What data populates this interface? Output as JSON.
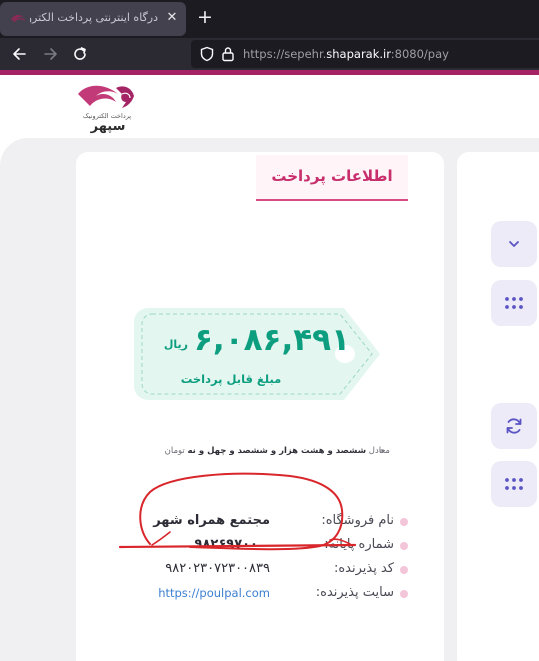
{
  "browser": {
    "tab_title": "درگاه اینترنتی پرداخت الکترونیک",
    "url_prefix": "https://sepehr.",
    "url_host": "shaparak.ir",
    "url_suffix": ":8080/pay"
  },
  "logo": {
    "subtitle": "پرداخت الکترونیک",
    "name": "سپهر"
  },
  "header": {
    "title": "اطلاعات پرداخت"
  },
  "amount": {
    "value": "۶,۰۸۶,۴۹۱",
    "unit": "ریال",
    "label": "مبلغ قابل پرداخت"
  },
  "amount_words": {
    "prefix": "معادل",
    "words": "ششصد و هشت هزار و ششصد و چهل و نه",
    "unit": "تومان"
  },
  "merchant": {
    "rows": [
      {
        "label": "نام فروشگاه:",
        "value": "مجتمع همراه شهر"
      },
      {
        "label": "شماره پایانه:",
        "value": "۹۸۲۶۹۷۰۰"
      },
      {
        "label": "کد پذیرنده:",
        "value": "۹۸۲۰۲۳۰۷۲۳۰۰۸۳۹"
      },
      {
        "label": "سایت پذیرنده:",
        "value": "https://poulpal.com"
      }
    ]
  },
  "side_buttons": [
    {
      "icon": "chevron-down-icon"
    },
    {
      "icon": "grid-dots-icon"
    },
    {
      "icon": "refresh-icon"
    },
    {
      "icon": "grid-dots-icon"
    }
  ],
  "colors": {
    "accent": "#a52466",
    "header_text": "#c72e6b",
    "amount_green": "#0d9e7f",
    "scribble_red": "#d8262b",
    "side_button_bg": "#ecebf7",
    "side_button_icon": "#5b54c4"
  }
}
